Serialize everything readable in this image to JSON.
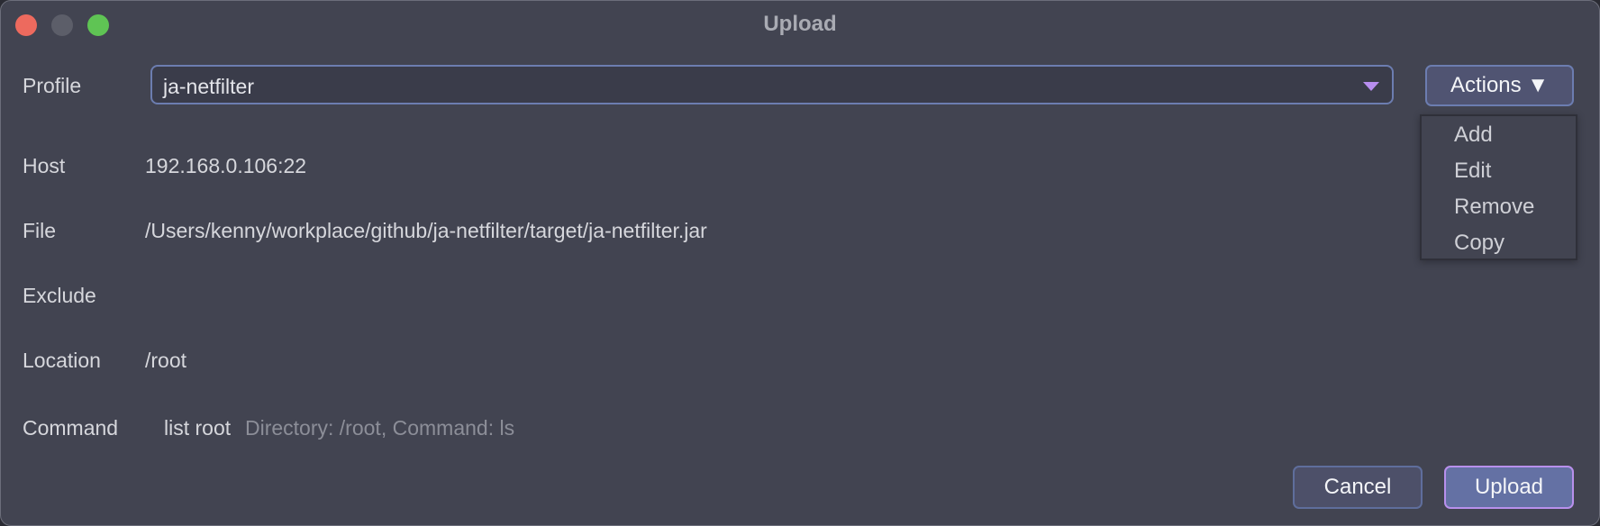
{
  "window": {
    "title": "Upload",
    "controls": [
      "close",
      "minimize",
      "maximize"
    ]
  },
  "form": {
    "profile": {
      "label": "Profile",
      "selected": "ja-netfilter"
    },
    "host": {
      "label": "Host",
      "value": "192.168.0.106:22"
    },
    "file": {
      "label": "File",
      "value": "/Users/kenny/workplace/github/ja-netfilter/target/ja-netfilter.jar"
    },
    "exclude": {
      "label": "Exclude",
      "value": ""
    },
    "location": {
      "label": "Location",
      "value": "/root"
    },
    "command": {
      "label": "Command",
      "value": "list root",
      "hint": "Directory: /root, Command: ls"
    }
  },
  "actions": {
    "label": "Actions ▼",
    "menu": [
      {
        "label": "Add"
      },
      {
        "label": "Edit"
      },
      {
        "label": "Remove"
      },
      {
        "label": "Copy"
      }
    ]
  },
  "buttons": {
    "cancel": "Cancel",
    "upload": "Upload"
  },
  "colors": {
    "background": "#424451",
    "accent_border": "#6c7db0",
    "primary_button": "#6471a4",
    "primary_focus": "#b890ec",
    "caret": "#b88ef0"
  }
}
